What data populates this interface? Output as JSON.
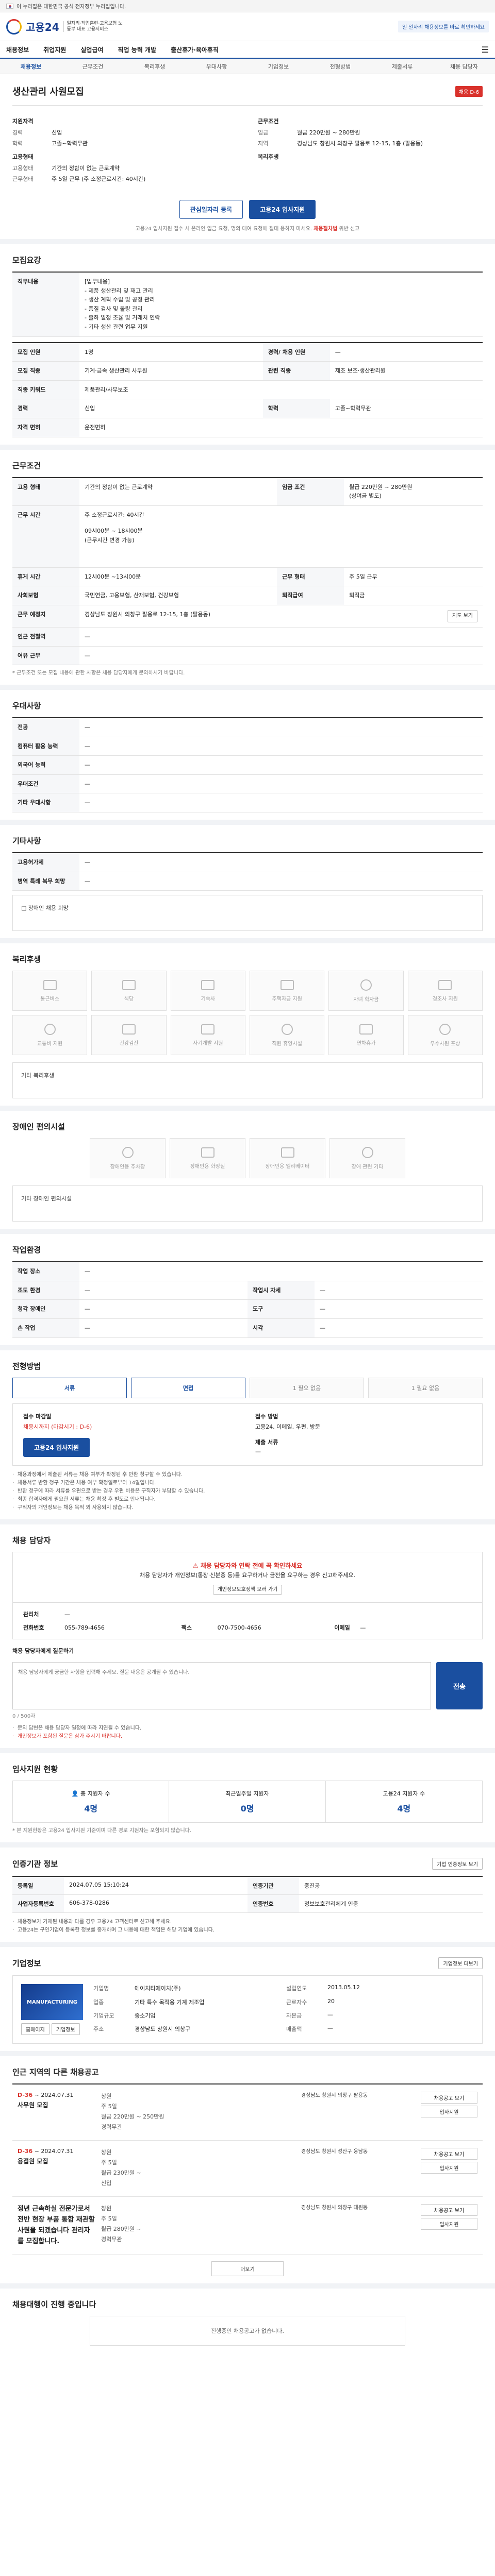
{
  "gov": {
    "text": "이 누리집은 대한민국 공식 전자정부 누리집입니다."
  },
  "header": {
    "logo": "고용24",
    "logo_sub": "일자리·직업훈련·고용보험 노동부 대표 고용서비스",
    "notice": "일 일자리 채용정보를 바로 확인하세요"
  },
  "gnb": [
    "채용정보",
    "취업지원",
    "실업급여",
    "직업 능력 개발",
    "출산휴가·육아휴직"
  ],
  "subnav": [
    "채용정보",
    "근무조건",
    "복리후생",
    "우대사항",
    "기업정보",
    "전형방법",
    "제출서류",
    "채용 담당자"
  ],
  "posting": {
    "title": "생산관리 사원모집",
    "badge": "채용 D-6",
    "left_label": "지원자격",
    "left": [
      [
        "경력",
        "신입"
      ],
      [
        "학력",
        "고졸~학력무관"
      ]
    ],
    "left_label2": "고용형태",
    "left2": [
      [
        "고용형태",
        "기간의 정함이 없는 근로계약"
      ],
      [
        "근무형태",
        "주 5일 근무 (주 소정근로시간: 40시간)"
      ]
    ],
    "right_label": "근무조건",
    "right": [
      [
        "임금",
        "월급 220만원 ~ 280만원"
      ],
      [
        "지역",
        "경상남도 창원시 의창구 팔용로 12-15, 1층 (팔용동)"
      ]
    ],
    "right_label2": "복리후생",
    "save_btn": "관심일자리 등록",
    "apply_btn": "고용24 입사지원",
    "note_pre": "고용24 입사지원 접수 시 온라인 입금 요청, 명의 대여 요청에 절대 응하지 마세요.",
    "note_red": "채용절차법",
    "note_post": "위반 신고"
  },
  "recruit": {
    "title": "모집요강",
    "sub": "직무내용",
    "duty": "[업무내용]\n - 제품 생산관리 및 재고 관리\n - 생산 계획 수립 및 공정 관리\n - 품질 검사 및 불량 관리\n - 출하 일정 조율 및 거래처 연락\n - 기타 생산 관련 업무 지원",
    "rows": [
      [
        "모집 인원",
        "1명",
        "경력/ 채용 인원",
        "—"
      ],
      [
        "모집 직종",
        "기계·금속 생산관리 사무원",
        "관련 직종",
        "제조 보조·생산관리원"
      ],
      [
        "직종 키워드",
        "제품관리/사무보조",
        "",
        ""
      ],
      [
        "경력",
        "신입",
        "학력",
        "고졸~학력무관"
      ],
      [
        "자격 면허",
        "운전면허",
        "",
        ""
      ]
    ]
  },
  "work": {
    "title": "근무조건",
    "rows": [
      [
        "고용 형태",
        "기간의 정함이 없는 근로계약",
        "임금 조건",
        "월급 220만원 ~ 280만원\n(상여금 별도)"
      ],
      [
        "근무 시간",
        "",
        "",
        ""
      ],
      [
        "휴게 시간",
        "12시00분 ~13시00분",
        "근무 형태",
        "주 5일 근무"
      ],
      [
        "사회보험",
        "국민연금, 고용보험, 산재보험, 건강보험",
        "퇴직급여",
        "퇴직금"
      ],
      [
        "근무 예정지",
        "경상남도 창원시 의창구 팔용로 12-15, 1층 (팔용동)",
        "",
        ""
      ],
      [
        "인근 전철역",
        "—",
        "",
        ""
      ],
      [
        "여유 근무",
        "—",
        "",
        ""
      ]
    ],
    "hours": "주 소정근로시간: 40시간",
    "hours_detail": "09시00분 ~ 18시00분\n(근무시간 변경 가능)",
    "map_btn": "지도 보기",
    "note": "* 근무조건 또는 모집 내용에 관한 사항은 채용 담당자에게 문의하시기 바랍니다."
  },
  "prefer": {
    "title": "우대사항",
    "rows": [
      [
        "전공",
        "—"
      ],
      [
        "컴퓨터 활용 능력",
        "—"
      ],
      [
        "외국어 능력",
        "—"
      ],
      [
        "우대조건",
        "—"
      ],
      [
        "기타 우대사항",
        "—"
      ]
    ]
  },
  "etc": {
    "title": "기타사항",
    "rows": [
      [
        "고용허가제",
        "—"
      ],
      [
        "병역 특례 복무 희망",
        "—"
      ]
    ],
    "check": "□ 장애인 채용 희망"
  },
  "welfare": {
    "title": "복리후생",
    "items": [
      "통근버스",
      "식당",
      "기숙사",
      "주택자금 지원",
      "자녀 학자금",
      "경조사 지원",
      "교통비 지원",
      "건강검진",
      "자기개발 지원",
      "직원 휴양시설",
      "연차휴가",
      "우수사원 포상"
    ],
    "empty": "기타 복리후생"
  },
  "disabled": {
    "title": "장애인 편의시설",
    "items": [
      "장애인용 주차장",
      "장애인용 화장실",
      "장애인용 엘리베이터",
      "장애 관련 기타"
    ],
    "empty": "기타 장애인 편의시설"
  },
  "company_env": {
    "title": "작업환경",
    "rows": [
      [
        "작업 장소",
        "—",
        "",
        ""
      ],
      [
        "조도 환경",
        "—",
        "작업시 자세",
        "—"
      ],
      [
        "청각 장애인",
        "—",
        "도구",
        "—"
      ],
      [
        "손 작업",
        "—",
        "시각",
        "—"
      ]
    ]
  },
  "process": {
    "title": "전형방법",
    "steps": [
      "서류",
      "면접",
      "1 필요 없음",
      "1 필요 없음"
    ],
    "doc_k": "접수 마감일",
    "doc_v": "채용시까지 (마감시기 : D-6)",
    "way_k": "접수 방법",
    "way_v": "고용24, 이메일, 우편, 방문",
    "form_k": "제출 서류",
    "form_v": "—",
    "apply": "고용24 입사지원",
    "bullets": [
      "채용과정에서 제출된 서류는 채용 여부가 확정된 후 반환 청구할 수 있습니다.",
      "채용서류 반환 청구 기간은 채용 여부 확정일로부터 14일입니다.",
      "반환 청구에 따라 서류를 우편으로 받는 경우 우편 비용은 구직자가 부담할 수 있습니다.",
      "최종 합격자에게 필요한 서류는 채용 확정 후 별도로 안내됩니다.",
      "구직자의 개인정보는 채용 목적 외 사용되지 않습니다."
    ]
  },
  "contact": {
    "title": "채용 담당자",
    "warn": "채용 담당자와 연락 전에 꼭 확인하세요",
    "warn_body": "채용 담당자가 개인정보(통장·신분증 등)를 요구하거나 금전을 요구하는 경우 신고해주세요.",
    "btn": "개인정보보호정책 보러 가기",
    "name_k": "관리처",
    "name_v": "—",
    "tel_k": "전화번호",
    "tel_v": "055-789-4656",
    "fax_k": "팩스",
    "fax_v": "070-7500-4656",
    "mail_k": "이메일",
    "mail_v": "—",
    "q_label": "채용 담당자에게 질문하기",
    "q_ph": "채용 담당자에게 궁금한 사항을 입력해 주세요. 질문 내용은 공개될 수 있습니다.",
    "q_btn": "전송",
    "q_count": "0 / 500자",
    "q_bullets": [
      "문의 답변은 채용 담당자 일정에 따라 지연될 수 있습니다.",
      "개인정보가 포함된 질문은 삼가 주시기 바랍니다."
    ]
  },
  "stats": {
    "title": "입사지원 현황",
    "items": [
      [
        "총 지원자 수",
        "4명"
      ],
      [
        "최근일주일 지원자",
        "0명"
      ],
      [
        "고용24 지원자 수",
        "4명"
      ]
    ],
    "note": "* 본 지원현황은 고용24 입사지원 기준이며 다른 경로 지원자는 포함되지 않습니다."
  },
  "info": {
    "title": "인증기관 정보",
    "btn": "기업 인증정보 보기",
    "rows": [
      [
        "등록일",
        "2024.07.05 15:10:24",
        "인증기관",
        "중진공"
      ],
      [
        "사업자등록번호",
        "606-378-0286",
        "인증번호",
        "정보보호관리체계 인증"
      ]
    ],
    "notes": [
      "채용정보가 기재된 내용과 다를 경우 고용24 고객센터로 신고해 주세요.",
      "고용24는 구인기업이 등록한 정보를 중개하며 그 내용에 대한 책임은 해당 기업에 있습니다."
    ]
  },
  "company": {
    "title": "기업정보",
    "btn": "기업정보 더보기",
    "logo": "MANUFACTURING",
    "name_k": "기업명",
    "name_v": "에이치티에이치(주)",
    "biz_k": "업종",
    "biz_v": "기타 특수 목적용 기계 제조업",
    "size_k": "기업규모",
    "size_v": "중소기업",
    "est_k": "설립연도",
    "est_v": "2013.05.12",
    "emp_k": "근로자수",
    "emp_v": "20",
    "cap_k": "자본금",
    "cap_v": "—",
    "addr_k": "주소",
    "addr_v": "경상남도 창원시 의창구",
    "sales_k": "매출액",
    "sales_v": "—",
    "home": "홈페이지",
    "mini": "기업정보"
  },
  "nearby": {
    "title": "인근 지역의 다른 채용공고",
    "jobs": [
      {
        "d": "D-36",
        "date": "~ 2024.07.31",
        "name": "사무원 모집",
        "meta": [
          "창원",
          "주 5일",
          "월급 220만원 ~ 250만원",
          "경력무관"
        ],
        "co": "경상남도 창원시 의창구 팔용동",
        "b1": "채용공고 보기",
        "b2": "입사지원"
      },
      {
        "d": "D-36",
        "date": "~ 2024.07.31",
        "name": "용접원 모집",
        "meta": [
          "창원",
          "주 5일",
          "월급 230만원 ~",
          "신입"
        ],
        "co": "경상남도 창원시 성산구 웅남동",
        "b1": "채용공고 보기",
        "b2": "입사지원"
      },
      {
        "d": "",
        "date": "",
        "name": "",
        "big": "정년 근속하실 전문가로서 전반 현장 부품 통합 재관할 사원을 되겠습니다 관리자를 모집합니다.",
        "meta": [
          "창원",
          "주 5일",
          "월급 280만원 ~",
          "경력무관"
        ],
        "co": "경상남도 창원시 의창구 대원동",
        "b1": "채용공고 보기",
        "b2": "입사지원"
      }
    ],
    "more": "더보기"
  },
  "lastsec": {
    "title": "채용대행이 진행 중입니다",
    "empty": "진행중인 채용공고가 없습니다."
  }
}
